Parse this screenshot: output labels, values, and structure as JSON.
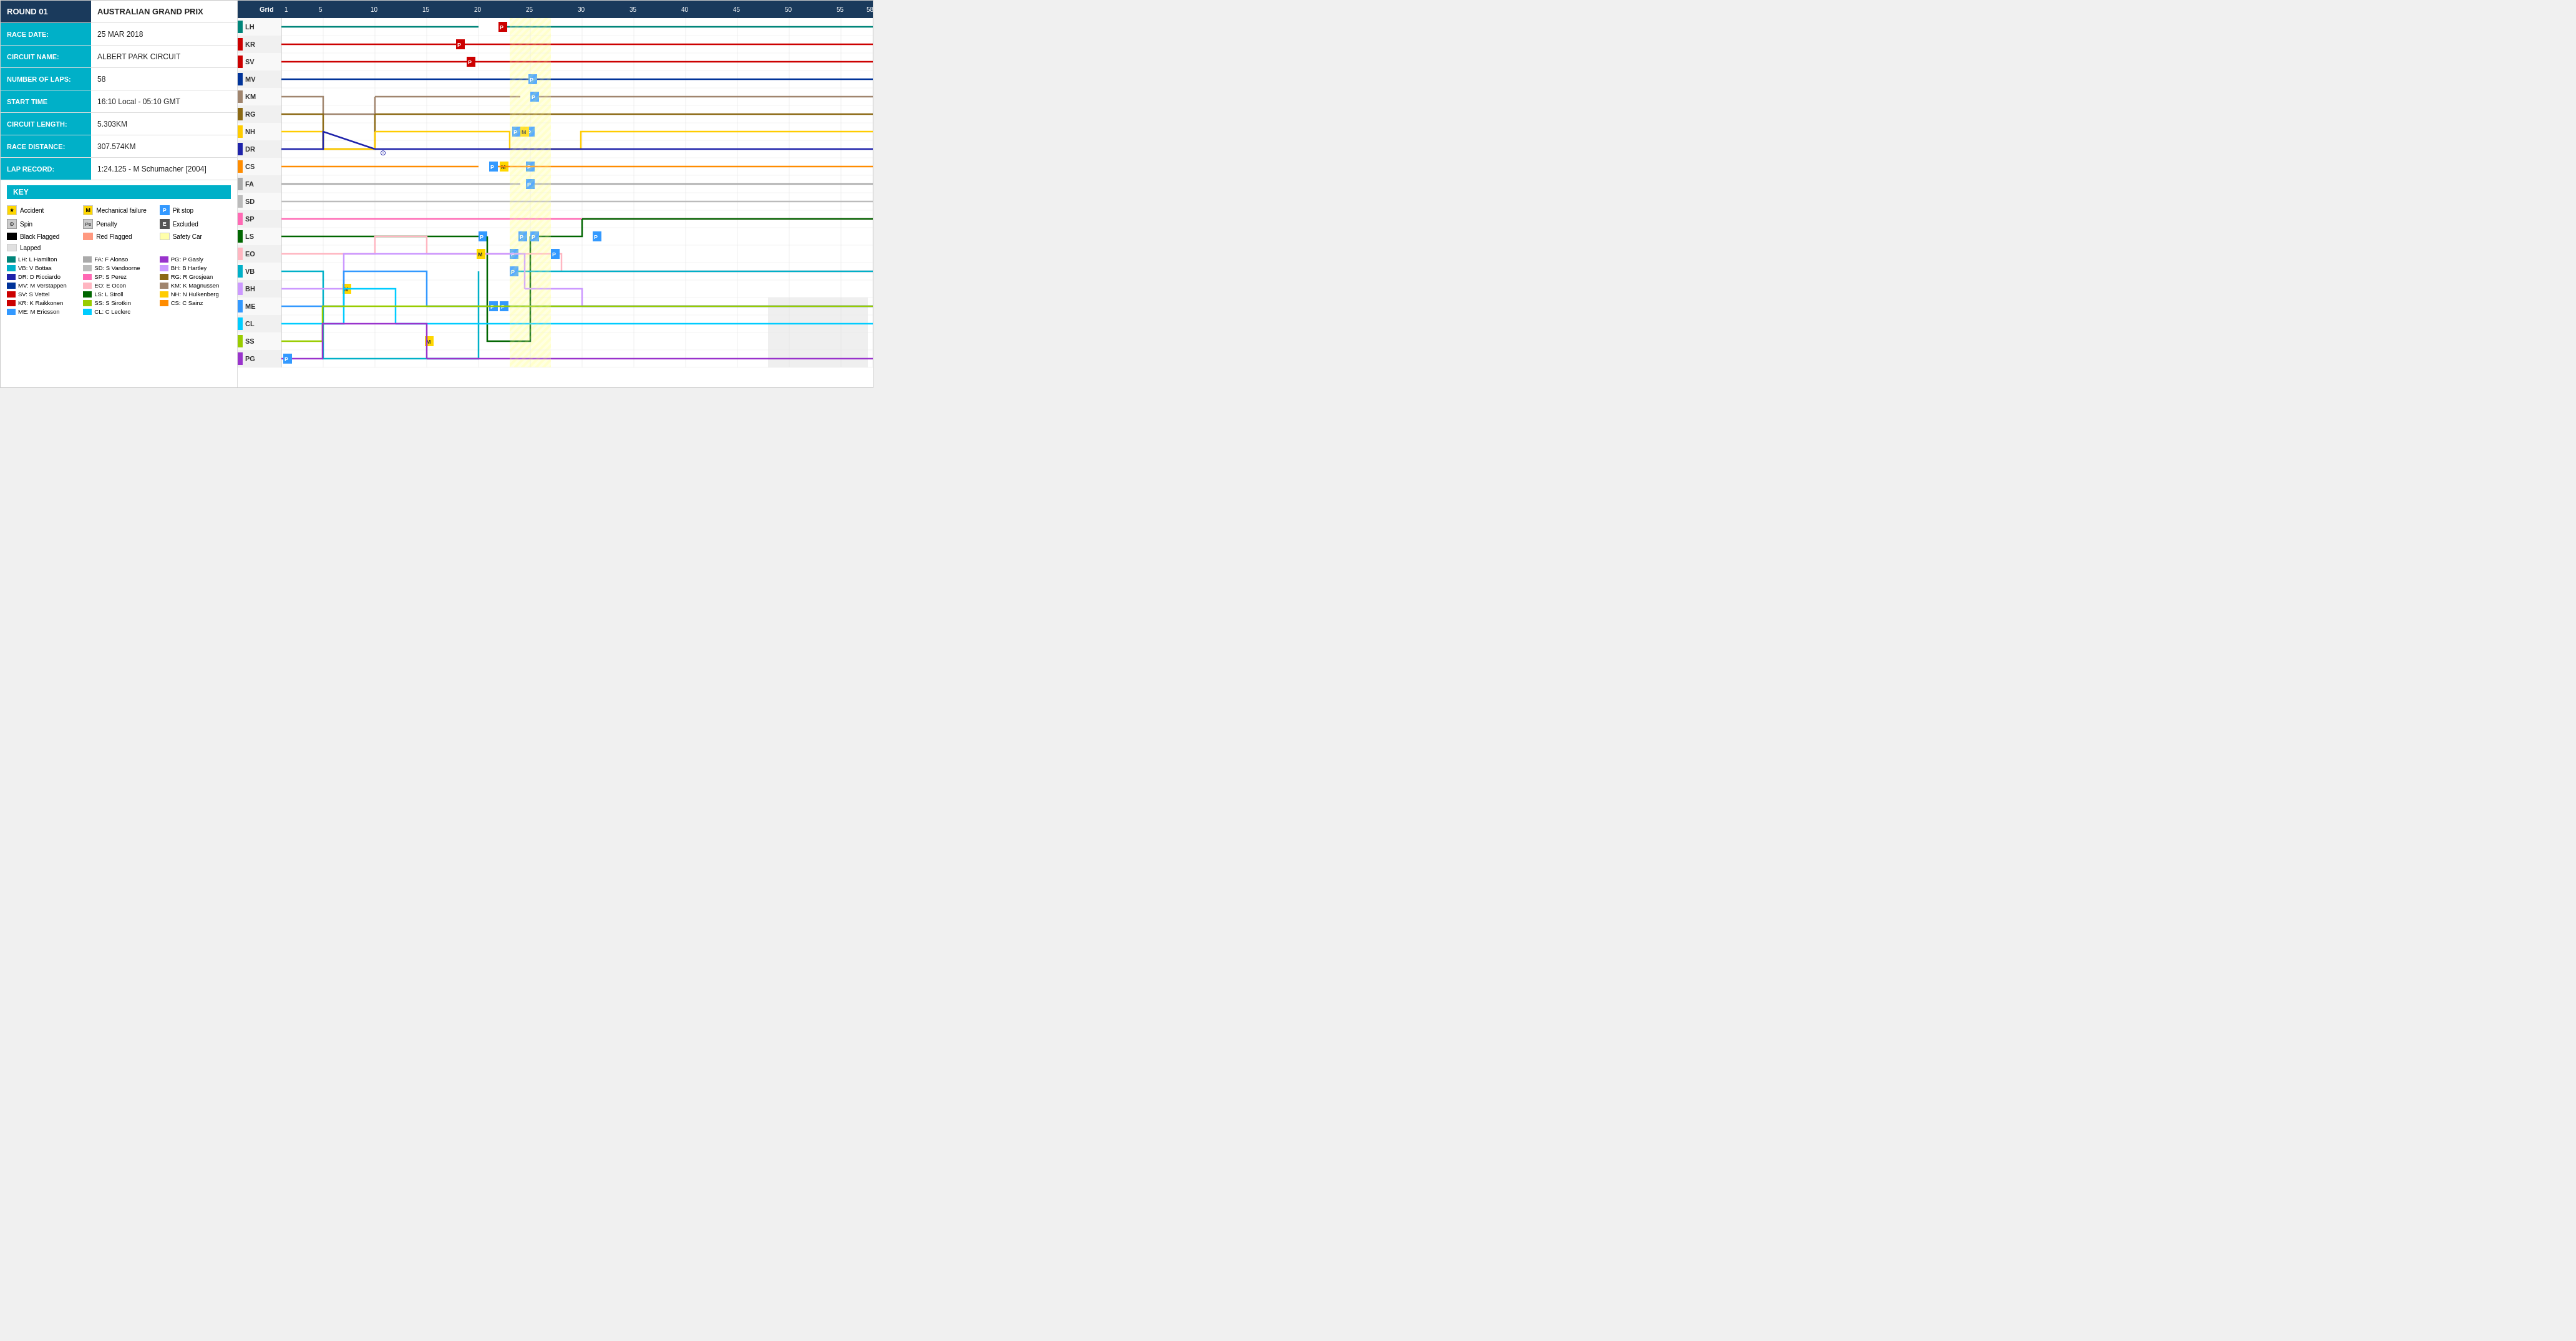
{
  "leftPanel": {
    "round": {
      "label": "ROUND 01",
      "value": "AUSTRALIAN GRAND PRIX"
    },
    "raceDate": {
      "label": "RACE DATE:",
      "value": "25 MAR 2018"
    },
    "circuitName": {
      "label": "CIRCUIT NAME:",
      "value": "ALBERT PARK CIRCUIT"
    },
    "numberOfLaps": {
      "label": "NUMBER OF LAPS:",
      "value": "58"
    },
    "startTime": {
      "label": "START TIME",
      "value": "16:10 Local - 05:10 GMT"
    },
    "circuitLength": {
      "label": "CIRCUIT LENGTH:",
      "value": "5.303KM"
    },
    "raceDistance": {
      "label": "RACE DISTANCE:",
      "value": "307.574KM"
    },
    "lapRecord": {
      "label": "LAP RECORD:",
      "value": "1:24.125 - M Schumacher [2004]"
    }
  },
  "key": {
    "title": "KEY",
    "items": [
      {
        "symbol": "★",
        "type": "accident",
        "label": "Accident"
      },
      {
        "symbol": "M",
        "type": "mechanical",
        "label": "Mechanical failure"
      },
      {
        "symbol": "P",
        "type": "pitstop",
        "label": "Pit stop"
      },
      {
        "symbol": "⊙",
        "type": "spin",
        "label": "Spin"
      },
      {
        "symbol": "Pe",
        "type": "penalty",
        "label": "Penalty"
      },
      {
        "symbol": "E",
        "type": "excluded",
        "label": "Excluded"
      },
      {
        "symbol": "",
        "type": "blackflag",
        "label": "Black Flagged"
      },
      {
        "symbol": "",
        "type": "redflag",
        "label": "Red Flagged"
      },
      {
        "symbol": "",
        "type": "safetycar",
        "label": "Safety Car"
      },
      {
        "symbol": "",
        "type": "lapped",
        "label": "Lapped"
      }
    ],
    "drivers": [
      {
        "code": "LH",
        "name": "L Hamilton",
        "color": "#00857a"
      },
      {
        "code": "VB",
        "name": "V Bottas",
        "color": "#00b0c8"
      },
      {
        "code": "DR",
        "name": "D Ricciardo",
        "color": "#1e22aa"
      },
      {
        "code": "MV",
        "name": "M Verstappen",
        "color": "#1e22aa"
      },
      {
        "code": "SV",
        "name": "S Vettel",
        "color": "#cc0000"
      },
      {
        "code": "KR",
        "name": "K Raikkonen",
        "color": "#cc0000"
      },
      {
        "code": "SP",
        "name": "S Perez",
        "color": "#ff69b4"
      },
      {
        "code": "EO",
        "name": "E Ocon",
        "color": "#ffb6c1"
      },
      {
        "code": "LS",
        "name": "L Stroll",
        "color": "#006600"
      },
      {
        "code": "SS",
        "name": "S Sirotkin",
        "color": "#99cc00"
      },
      {
        "code": "FA",
        "name": "F Alonso",
        "color": "#aaaaaa"
      },
      {
        "code": "SD",
        "name": "S Vandoorne",
        "color": "#bbbbbb"
      },
      {
        "code": "PG",
        "name": "P Gasly",
        "color": "#9933cc"
      },
      {
        "code": "BH",
        "name": "B Hartley",
        "color": "#cc99ff"
      },
      {
        "code": "RG",
        "name": "R Grosjean",
        "color": "#8b6914"
      },
      {
        "code": "KM",
        "name": "K Magnussen",
        "color": "#a0856e"
      },
      {
        "code": "NH",
        "name": "N Hulkenberg",
        "color": "#ffcc00"
      },
      {
        "code": "CS",
        "name": "C Sainz",
        "color": "#ff8c00"
      },
      {
        "code": "ME",
        "name": "M Ericsson",
        "color": "#3399ff"
      },
      {
        "code": "CL",
        "name": "C Leclerc",
        "color": "#00ccff"
      }
    ]
  },
  "chart": {
    "totalLaps": 58,
    "gridLabel": "Grid",
    "lapMarkers": [
      1,
      5,
      10,
      15,
      20,
      25,
      30,
      35,
      40,
      45,
      50,
      55,
      58
    ],
    "rows": [
      {
        "pos": "1",
        "driver": "LH"
      },
      {
        "pos": "2",
        "driver": "KR"
      },
      {
        "pos": "3",
        "driver": "SV"
      },
      {
        "pos": "4",
        "driver": "MV"
      },
      {
        "pos": "5",
        "driver": "KM"
      },
      {
        "pos": "6",
        "driver": "RG"
      },
      {
        "pos": "7",
        "driver": "NH"
      },
      {
        "pos": "8",
        "driver": "DR"
      },
      {
        "pos": "9",
        "driver": "CS"
      },
      {
        "pos": "10",
        "driver": "FA"
      },
      {
        "pos": "11",
        "driver": "SD"
      },
      {
        "pos": "12",
        "driver": "SP"
      },
      {
        "pos": "13",
        "driver": "LS"
      },
      {
        "pos": "14",
        "driver": "EO"
      },
      {
        "pos": "15",
        "driver": "VB"
      },
      {
        "pos": "16",
        "driver": "BH"
      },
      {
        "pos": "17",
        "driver": "ME"
      },
      {
        "pos": "18",
        "driver": "CL"
      },
      {
        "pos": "19",
        "driver": "SS"
      },
      {
        "pos": "20",
        "driver": "PG"
      }
    ]
  }
}
